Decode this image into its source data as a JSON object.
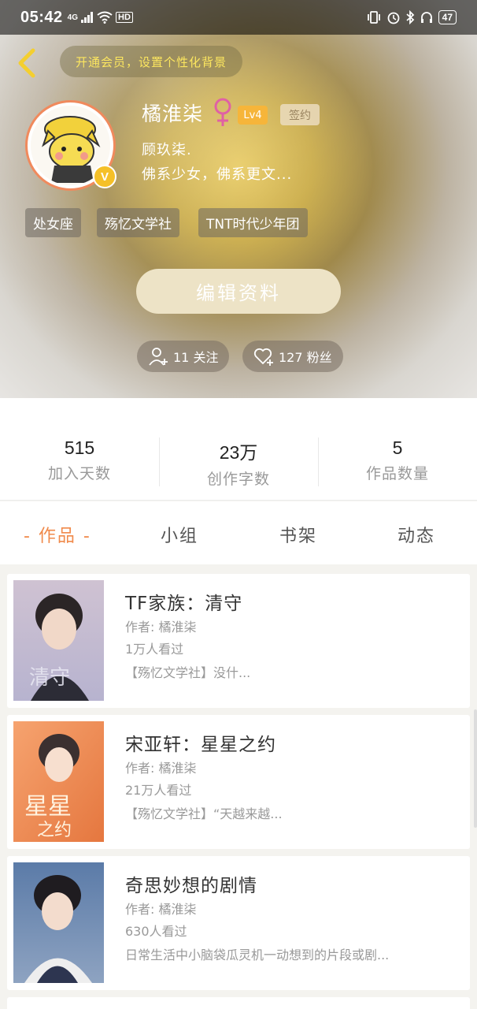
{
  "status_bar": {
    "time": "05:42",
    "network": "4G",
    "hd": "HD",
    "battery": "47"
  },
  "header": {
    "vip_banner": "开通会员，设置个性化背景"
  },
  "profile": {
    "name": "橘淮柒",
    "level": "Lv4",
    "sign_badge": "签约",
    "bio_line1": "顾玖柒.",
    "bio_line2": "佛系少女，佛系更文...",
    "tags": [
      "处女座",
      "殇忆文学社",
      "TNT时代少年团"
    ],
    "edit_button": "编辑资料",
    "following": "11 关注",
    "fans": "127 粉丝"
  },
  "stats": [
    {
      "value": "515",
      "label": "加入天数"
    },
    {
      "value": "23万",
      "label": "创作字数"
    },
    {
      "value": "5",
      "label": "作品数量"
    }
  ],
  "tabs": [
    "- 作品 -",
    "小组",
    "书架",
    "动态"
  ],
  "books": [
    {
      "title": "TF家族：清守",
      "author": "作者: 橘淮柒",
      "views": "1万人看过",
      "desc": "【殇忆文学社】没什..."
    },
    {
      "title": "宋亚轩：星星之约",
      "author": "作者: 橘淮柒",
      "views": "21万人看过",
      "desc": "【殇忆文学社】“天越来越..."
    },
    {
      "title": "奇思妙想的剧情",
      "author": "作者: 橘淮柒",
      "views": "630人看过",
      "desc": "日常生活中小脑袋瓜灵机一动想到的片段或剧..."
    }
  ],
  "colors": {
    "accent": "#f08a4b",
    "vip_text": "#fce65f",
    "lv_badge": "#f6b53a",
    "gender": "#e061a4"
  }
}
